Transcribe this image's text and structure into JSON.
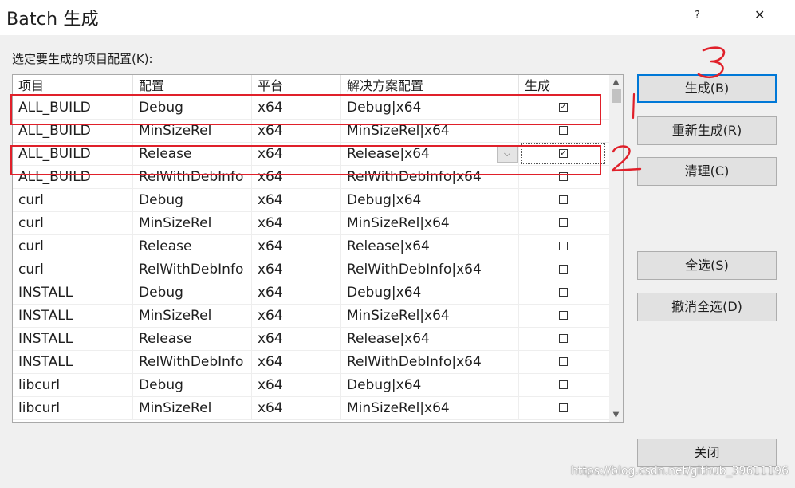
{
  "window": {
    "title": "Batch 生成",
    "help_label": "?",
    "close_label": "✕"
  },
  "prompt": "选定要生成的项目配置(K):",
  "columns": [
    "项目",
    "配置",
    "平台",
    "解决方案配置",
    "生成"
  ],
  "rows": [
    {
      "project": "ALL_BUILD",
      "config": "Debug",
      "platform": "x64",
      "solution": "Debug|x64",
      "build": true
    },
    {
      "project": "ALL_BUILD",
      "config": "MinSizeRel",
      "platform": "x64",
      "solution": "MinSizeRel|x64",
      "build": false
    },
    {
      "project": "ALL_BUILD",
      "config": "Release",
      "platform": "x64",
      "solution": "Release|x64",
      "build": true
    },
    {
      "project": "ALL_BUILD",
      "config": "RelWithDebInfo",
      "platform": "x64",
      "solution": "RelWithDebInfo|x64",
      "build": false
    },
    {
      "project": "curl",
      "config": "Debug",
      "platform": "x64",
      "solution": "Debug|x64",
      "build": false
    },
    {
      "project": "curl",
      "config": "MinSizeRel",
      "platform": "x64",
      "solution": "MinSizeRel|x64",
      "build": false
    },
    {
      "project": "curl",
      "config": "Release",
      "platform": "x64",
      "solution": "Release|x64",
      "build": false
    },
    {
      "project": "curl",
      "config": "RelWithDebInfo",
      "platform": "x64",
      "solution": "RelWithDebInfo|x64",
      "build": false
    },
    {
      "project": "INSTALL",
      "config": "Debug",
      "platform": "x64",
      "solution": "Debug|x64",
      "build": false
    },
    {
      "project": "INSTALL",
      "config": "MinSizeRel",
      "platform": "x64",
      "solution": "MinSizeRel|x64",
      "build": false
    },
    {
      "project": "INSTALL",
      "config": "Release",
      "platform": "x64",
      "solution": "Release|x64",
      "build": false
    },
    {
      "project": "INSTALL",
      "config": "RelWithDebInfo",
      "platform": "x64",
      "solution": "RelWithDebInfo|x64",
      "build": false
    },
    {
      "project": "libcurl",
      "config": "Debug",
      "platform": "x64",
      "solution": "Debug|x64",
      "build": false
    },
    {
      "project": "libcurl",
      "config": "MinSizeRel",
      "platform": "x64",
      "solution": "MinSizeRel|x64",
      "build": false
    }
  ],
  "buttons": {
    "build": "生成(B)",
    "rebuild": "重新生成(R)",
    "clean": "清理(C)",
    "select_all": "全选(S)",
    "deselect_all": "撤消全选(D)",
    "close": "关闭"
  },
  "icons": {
    "dropdown": "chevron-down-icon",
    "scroll_up": "scroll-up-icon",
    "scroll_down": "scroll-down-icon"
  },
  "colors": {
    "annotation": "#e0202a",
    "focus": "#0078d7"
  },
  "watermark": "https://blog.csdn.net/github_39611196"
}
